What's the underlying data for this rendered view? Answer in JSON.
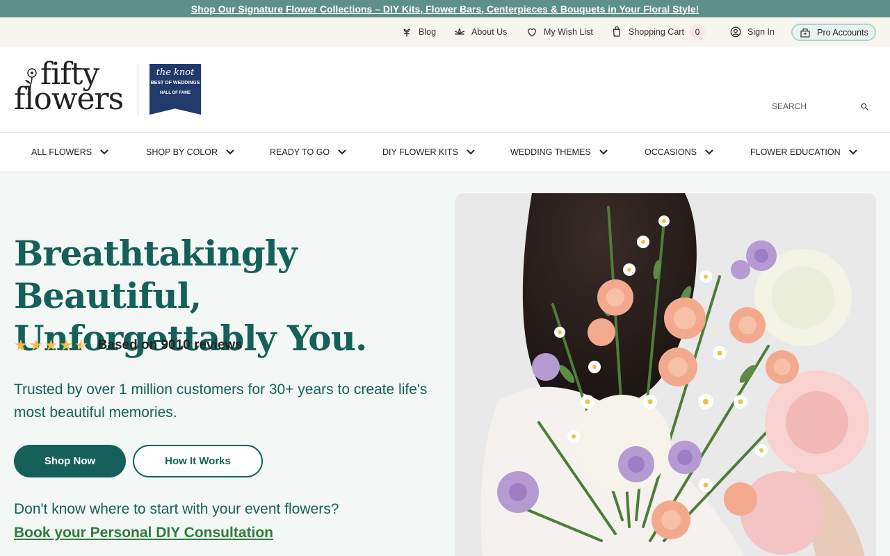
{
  "promo": {
    "text": "Shop Our Signature Flower Collections – DIY Kits, Flower Bars, Centerpieces & Bouquets in Your Floral Style!"
  },
  "utility": {
    "blog": "Blog",
    "about": "About Us",
    "wishlist": "My Wish List",
    "cart": "Shopping Cart",
    "cart_count": "0",
    "signin": "Sign In",
    "pro": "Pro Accounts"
  },
  "brand": {
    "logo_line1": "fifty",
    "logo_line2": "flowers",
    "badge_line1": "the knot",
    "badge_line2": "BEST OF WEDDINGS",
    "badge_line3": "HALL OF FAME"
  },
  "search": {
    "placeholder": "SEARCH"
  },
  "nav": {
    "items": [
      {
        "label": "ALL FLOWERS"
      },
      {
        "label": "SHOP BY COLOR"
      },
      {
        "label": "READY TO GO"
      },
      {
        "label": "DIY FLOWER KITS"
      },
      {
        "label": "WEDDING THEMES"
      },
      {
        "label": "OCCASIONS"
      },
      {
        "label": "FLOWER EDUCATION"
      }
    ]
  },
  "hero": {
    "headline": "Breathtakingly Beautiful, Unforgettably You.",
    "rating_value": 4.5,
    "rating_text": "Based on 9010 reviews",
    "subtext": "Trusted by over 1 million customers for 30+ years to create life's most beautiful memories.",
    "shop_now": "Shop Now",
    "how_it_works": "How It Works",
    "prompt": "Don't know where to start with your event flowers?",
    "consult_link": "Book your Personal DIY Consultation"
  },
  "colors": {
    "promo_bg": "#5e8f8a",
    "brand_green": "#15605a",
    "link_green": "#2e7d3a",
    "star": "#f3bd46",
    "knot_navy": "#1f3a6b"
  }
}
